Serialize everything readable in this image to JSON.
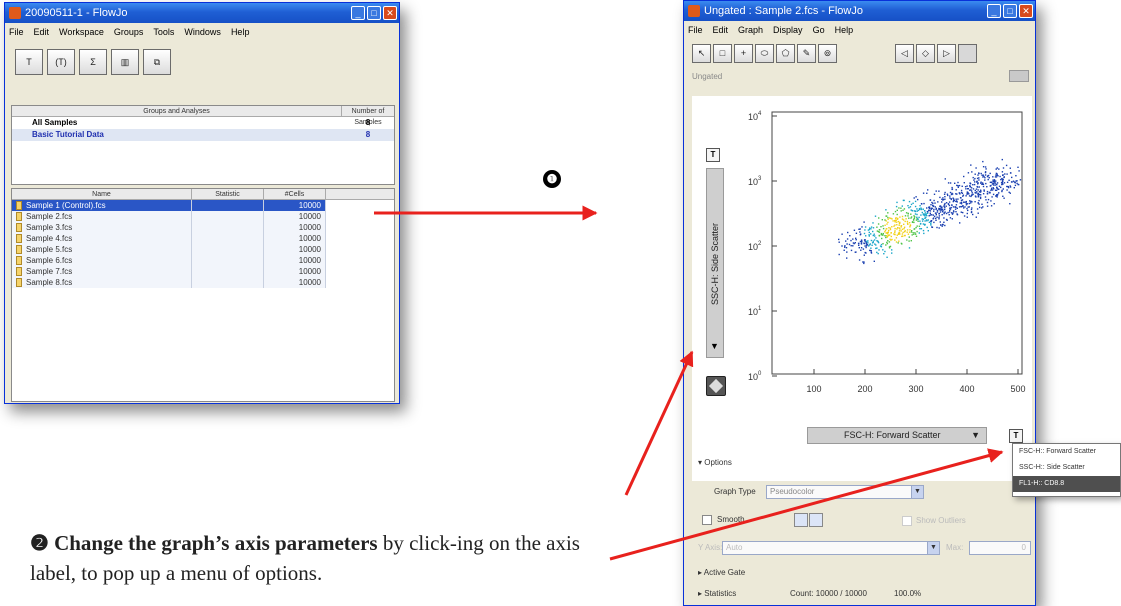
{
  "workspace_window": {
    "title": "20090511-1 - FlowJo",
    "menu": [
      "File",
      "Edit",
      "Workspace",
      "Groups",
      "Tools",
      "Windows",
      "Help"
    ],
    "toolbar": [
      "T",
      "(T)",
      "Σ",
      "▥",
      "⧉"
    ],
    "groups_table": {
      "headers": [
        "Groups and Analyses",
        "Number of Samples"
      ],
      "rows": [
        {
          "name": "All Samples",
          "count": "8"
        },
        {
          "name": "Basic Tutorial Data",
          "count": "8"
        }
      ]
    },
    "samples_table": {
      "headers": [
        "Name",
        "Statistic",
        "#Cells"
      ],
      "rows": [
        {
          "name": "Sample 1 (Control).fcs",
          "cells": "10000"
        },
        {
          "name": "Sample 2.fcs",
          "cells": "10000"
        },
        {
          "name": "Sample 3.fcs",
          "cells": "10000"
        },
        {
          "name": "Sample 4.fcs",
          "cells": "10000"
        },
        {
          "name": "Sample 5.fcs",
          "cells": "10000"
        },
        {
          "name": "Sample 6.fcs",
          "cells": "10000"
        },
        {
          "name": "Sample 7.fcs",
          "cells": "10000"
        },
        {
          "name": "Sample 8.fcs",
          "cells": "10000"
        }
      ]
    }
  },
  "graph_window": {
    "title": "Ungated : Sample 2.fcs - FlowJo",
    "menu": [
      "File",
      "Edit",
      "Graph",
      "Display",
      "Go",
      "Help"
    ],
    "gate_label": "Ungated",
    "y_axis_label": "SSC-H: Side Scatter",
    "x_axis_label": "FSC-H: Forward Scatter",
    "y_ticks": [
      "10",
      "10",
      "10",
      "10",
      "10"
    ],
    "y_exponents": [
      "4",
      "3",
      "2",
      "1",
      "0"
    ],
    "x_ticks": [
      "100",
      "200",
      "300",
      "400",
      "500"
    ],
    "options": {
      "header": "Options",
      "graph_type_label": "Graph Type",
      "graph_type_value": "Pseudocolor",
      "smooth_label": "Smooth",
      "show_outliers_label": "Show Outliers",
      "y_axis_label": "Y Axis:",
      "y_axis_value": "Auto",
      "max_label": "Max:",
      "max_value": "0"
    },
    "active_gate_label": "Active Gate",
    "statistics_label": "Statistics",
    "count_text": "Count: 10000 / 10000",
    "percent_text": "100.0%"
  },
  "axis_popup": {
    "items": [
      "FSC-H:: Forward Scatter",
      "SSC-H:: Side Scatter",
      "FL1-H:: CD8.8"
    ],
    "highlighted_index": 2
  },
  "annotations": {
    "step1": "❶",
    "step2_badge": "❷",
    "step2_bold": "Change the graph’s axis parameters",
    "step2_rest": " by click-ing on the axis label, to pop up a menu of options."
  },
  "colors": {
    "arrow_red": "#e8211d",
    "selection_blue": "#2a56c6",
    "title_blue": "#1f5fd4"
  }
}
